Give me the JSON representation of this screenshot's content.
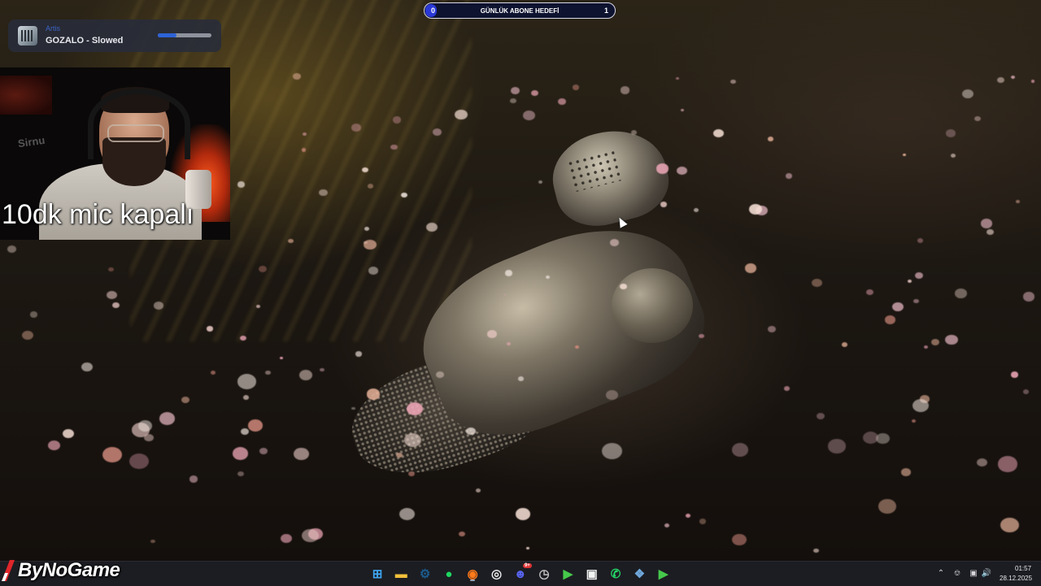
{
  "now_playing": {
    "artist": "Artis",
    "title": "GOZALO - Slowed",
    "progress": 0.35
  },
  "webcam": {
    "overlay_text": "10dk mic kapalı",
    "shirt_text": "Sirnu"
  },
  "subscriber_goal": {
    "title": "GÜNLÜK ABONE HEDEFİ",
    "current": "0",
    "target": "1",
    "progress": 0.05
  },
  "watermark": {
    "brand": "ByNoGame"
  },
  "taskbar": {
    "apps": [
      {
        "name": "windows-start",
        "icon": "windows-icon",
        "color": "#3ea6f3"
      },
      {
        "name": "file-explorer",
        "icon": "folder-icon",
        "color": "#f2c13b"
      },
      {
        "name": "steam",
        "icon": "steam-icon",
        "color": "#1b5a8c"
      },
      {
        "name": "spotify",
        "icon": "spotify-icon",
        "color": "#1ed760"
      },
      {
        "name": "firefox",
        "icon": "firefox-icon",
        "color": "#ff7a1a"
      },
      {
        "name": "obs",
        "icon": "obs-icon",
        "color": "#e8e8e8"
      },
      {
        "name": "discord",
        "icon": "discord-icon",
        "color": "#5865f2",
        "badge": "9+"
      },
      {
        "name": "app-clock",
        "icon": "clock-app-icon",
        "color": "#bdbdbd"
      },
      {
        "name": "game-launcher-1",
        "icon": "play-icon",
        "color": "#46c94b"
      },
      {
        "name": "epic-games",
        "icon": "epic-icon",
        "color": "#f2f2f2"
      },
      {
        "name": "whatsapp",
        "icon": "whatsapp-icon",
        "color": "#25d366"
      },
      {
        "name": "network-app",
        "icon": "network-icon",
        "color": "#6fa8dc"
      },
      {
        "name": "game-launcher-2",
        "icon": "play-icon",
        "color": "#46c94b"
      }
    ]
  },
  "tray": {
    "time": "01:57",
    "date": "28.12.2025"
  }
}
